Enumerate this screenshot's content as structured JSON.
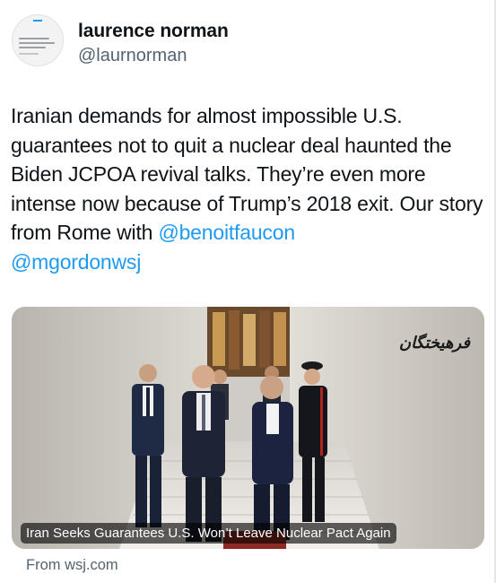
{
  "author": {
    "display_name": "laurence norman",
    "handle": "@laurnorman",
    "avatar_icon": "profile-screenshot-avatar"
  },
  "tweet": {
    "text_before": "Iranian demands for almost impossible U.S. guarantees not to quit a nuclear deal haunted the Biden JCPOA revival talks. They’re even more intense now because of Trump’s 2018 exit. Our story from Rome with ",
    "mention_1": "@benoitfaucon",
    "mention_2": "@mgordonwsj"
  },
  "card": {
    "headline": "Iran Seeks Guarantees U.S. Won’t Leave Nuclear Pact Again",
    "watermark": "فرهیختگان",
    "source": "From wsj.com"
  },
  "colors": {
    "text": "#0f1419",
    "secondary": "#536471",
    "link": "#1d9bf0"
  }
}
